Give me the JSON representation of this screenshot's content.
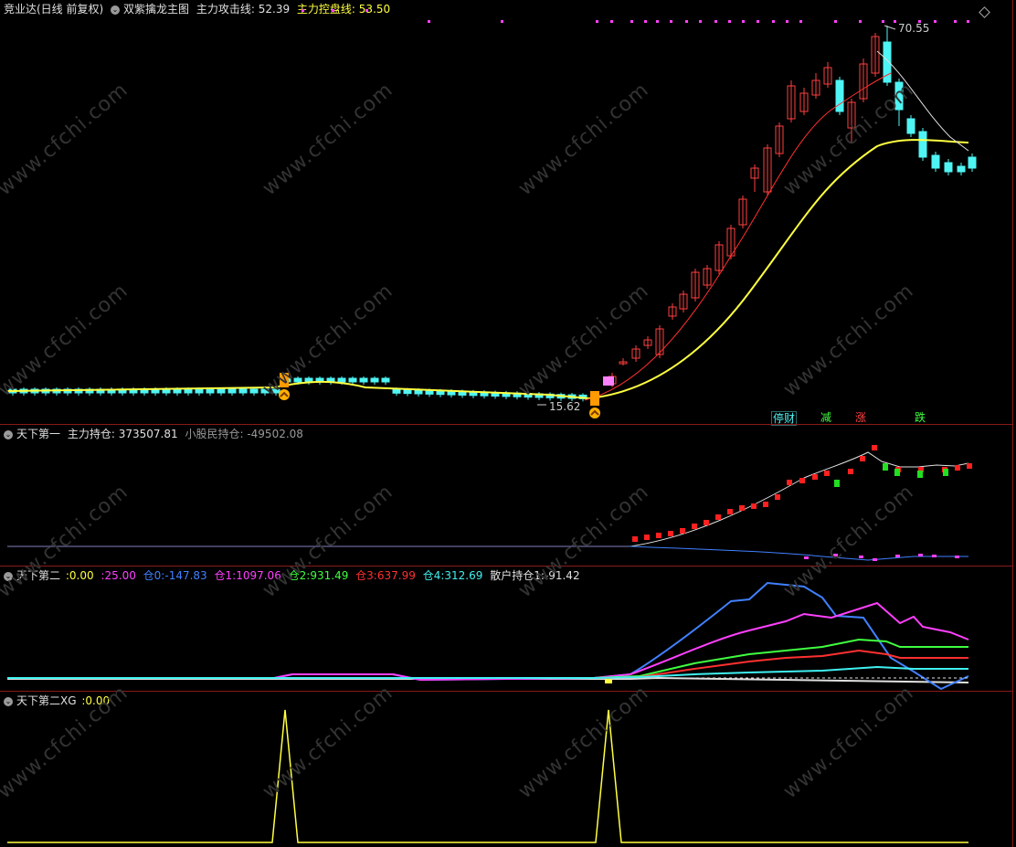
{
  "main": {
    "stock_name": "竞业达(日线 前复权)",
    "indicator_name": "双紫擒龙主图",
    "attack_line_label": "主力攻击线:",
    "attack_line_value": "52.39",
    "control_line_label": "主力控盘线:",
    "control_line_value": "53.50",
    "high_label": "70.55",
    "low_label": "15.62",
    "events": [
      "停财",
      "减",
      "涨",
      "跌"
    ],
    "colors": {
      "attack": "#ff3030",
      "control": "#ffff40",
      "up": "#ff4040",
      "down": "#4ff4f4"
    }
  },
  "panel1": {
    "name": "天下第一",
    "main_hold_label": "主力持仓:",
    "main_hold_value": "373507.81",
    "retail_hold_label": "小股民持仓:",
    "retail_hold_value": "-49502.08"
  },
  "panel2": {
    "name": "天下第二",
    "fields": [
      {
        "label": ":",
        "value": "0.00",
        "color": "#ffff40"
      },
      {
        "label": ":",
        "value": "25.00",
        "color": "#ff40ff"
      },
      {
        "label": "仓0:",
        "value": "-147.83",
        "color": "#4080ff"
      },
      {
        "label": "仓1:",
        "value": "1097.06",
        "color": "#ff40ff"
      },
      {
        "label": "仓2:",
        "value": "931.49",
        "color": "#40ff40"
      },
      {
        "label": "仓3:",
        "value": "637.99",
        "color": "#ff3030"
      },
      {
        "label": "仓4:",
        "value": "312.69",
        "color": "#40f0f0"
      },
      {
        "label": "散户持仓1:",
        "value": "-91.42",
        "color": "#e0e0e0"
      }
    ]
  },
  "panel3": {
    "name": "天下第二XG",
    "label": ":",
    "value": "0.00"
  },
  "watermark": "www.cfchi.com"
}
